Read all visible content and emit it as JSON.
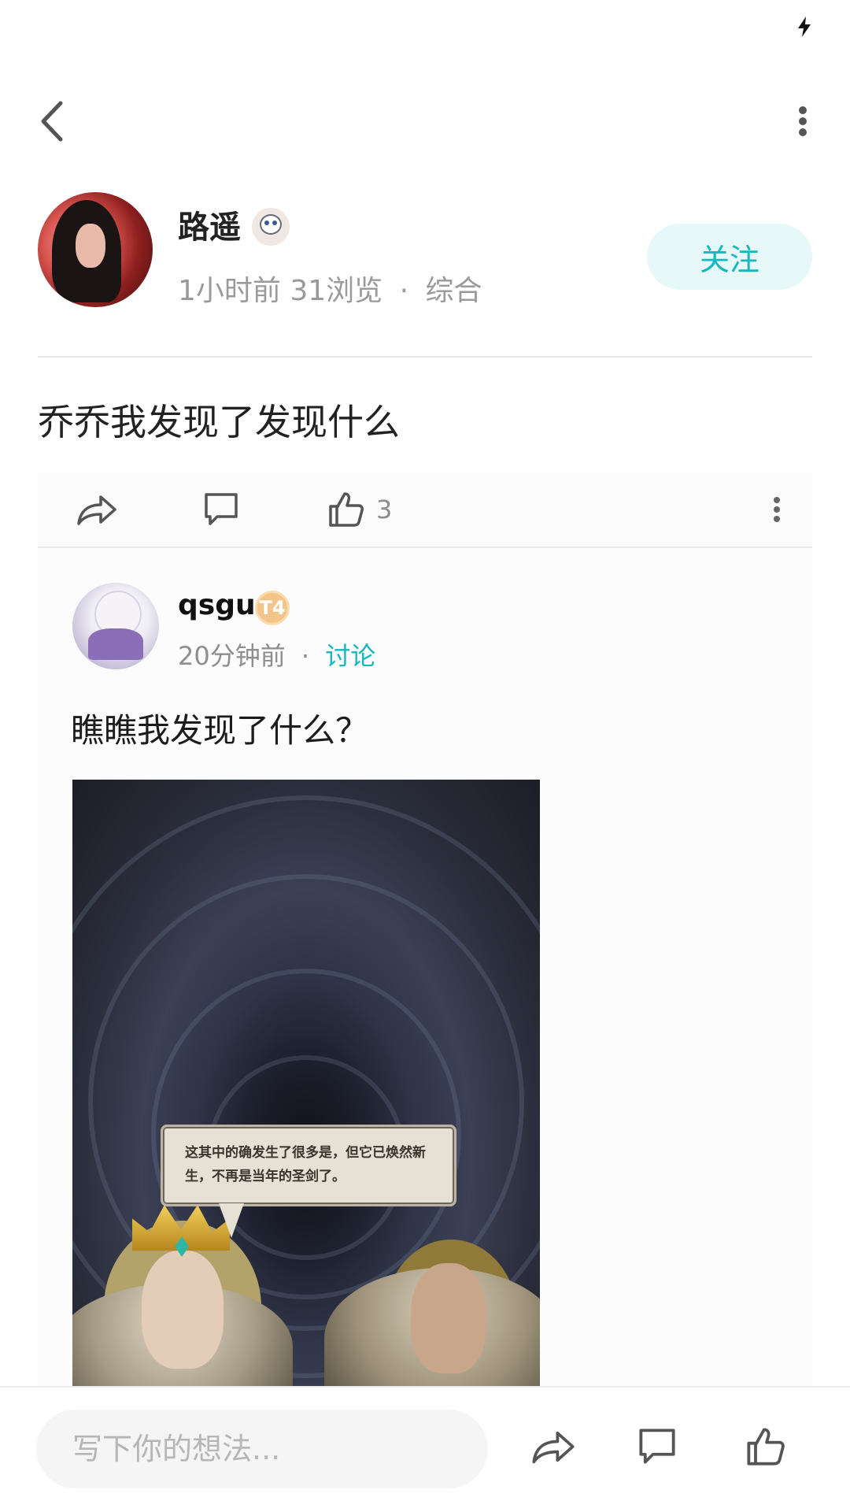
{
  "author": {
    "name": "路遥",
    "time": "1小时前",
    "views": "31浏览",
    "separator": "·",
    "category": "综合",
    "follow_label": "关注"
  },
  "post": {
    "title": "乔乔我发现了发现什么",
    "like_count": "3"
  },
  "quoted": {
    "name": "qsgu",
    "badge": "T4",
    "time": "20分钟前",
    "separator": "·",
    "tag": "讨论",
    "text": "瞧瞧我发现了什么？",
    "image_caption": "这其中的确发生了很多是，但它已焕然新生，不再是当年的圣剑了。"
  },
  "bottom_bar": {
    "input_placeholder": "写下你的想法..."
  },
  "icons": {
    "back": "back-chevron-icon",
    "more": "more-vertical-icon",
    "share": "share-icon",
    "comment": "comment-icon",
    "like": "thumbs-up-icon",
    "charging": "charging-bolt-icon"
  },
  "colors": {
    "accent": "#17b7bf",
    "follow_bg": "#e7f8f8",
    "meta_text": "#9a9a9a"
  }
}
